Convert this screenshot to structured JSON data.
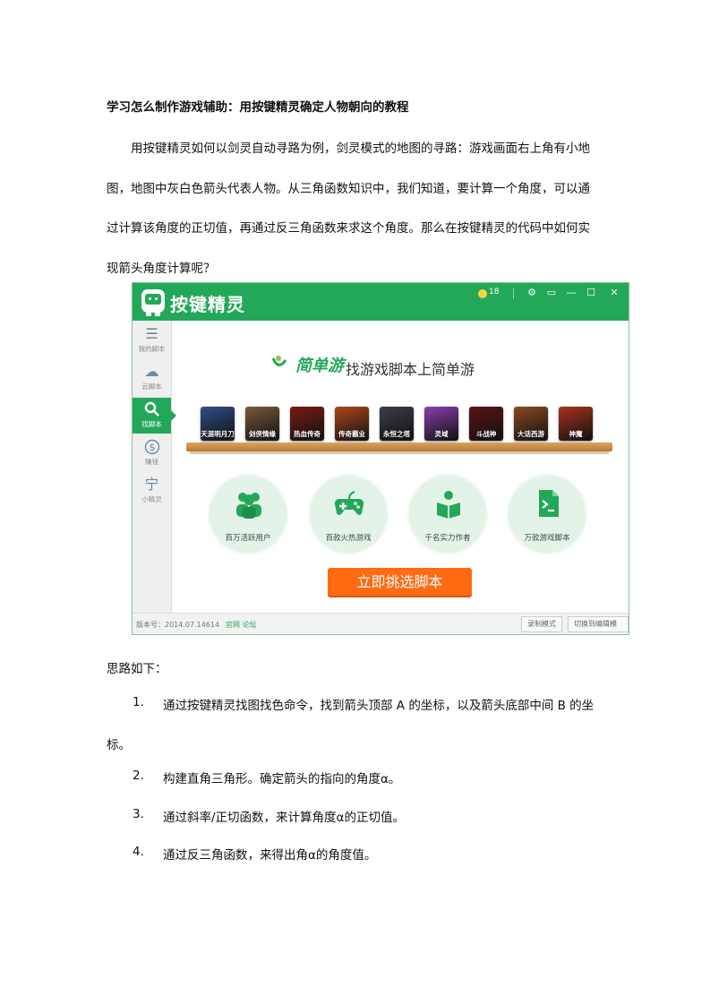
{
  "doc": {
    "title": "学习怎么制作游戏辅助：用按键精灵确定人物朝向的教程",
    "intro_lines": [
      "用按键精灵如何以剑灵自动寻路为例，剑灵模式的地图的寻路：游戏画面右上角有小地",
      "图，地图中灰白色箭头代表人物。从三角函数知识中，我们知道，要计算一个角度，可以通",
      "过计算该角度的正切值，再通过反三角函数来求这个角度。那么在按键精灵的代码中如何实",
      "现箭头角度计算呢？"
    ],
    "steps_heading": "思路如下：",
    "steps": [
      {
        "num": "1.",
        "text": "通过按键精灵找图找色命令，找到箭头顶部 A 的坐标，以及箭头底部中间 B 的坐",
        "cont": "标。"
      },
      {
        "num": "2.",
        "text": "构建直角三角形。确定箭头的指向的角度α。"
      },
      {
        "num": "3.",
        "text": "通过斜率/正切函数，来计算角度α的正切值。"
      },
      {
        "num": "4.",
        "text": "通过反三角函数，来得出角α的角度值。"
      }
    ]
  },
  "app": {
    "title": "按键精灵",
    "coin_value": "18",
    "window_buttons": [
      "⚙",
      "▭",
      "—",
      "☐",
      "✕"
    ],
    "sidebar": [
      {
        "label": "我的脚本",
        "icon": "list-icon"
      },
      {
        "label": "云脚本",
        "icon": "cloud-icon"
      },
      {
        "label": "找脚本",
        "icon": "search-icon"
      },
      {
        "label": "赚钱",
        "icon": "dollar-icon"
      },
      {
        "label": "小精灵",
        "icon": "user-icon"
      }
    ],
    "brand": "简单游",
    "slogan": "找游戏脚本上简单游",
    "games": [
      {
        "label": "天涯明月刀",
        "color": "#2e4f8a"
      },
      {
        "label": "剑侠情缘",
        "color": "#7a5a3a"
      },
      {
        "label": "热血传奇",
        "color": "#7a1a12"
      },
      {
        "label": "传奇霸业",
        "color": "#b0461c"
      },
      {
        "label": "永恒之塔",
        "color": "#3d3d4a"
      },
      {
        "label": "灵域",
        "color": "#8a3fae"
      },
      {
        "label": "斗战神",
        "color": "#5a1414"
      },
      {
        "label": "大话西游",
        "color": "#8a4a22"
      },
      {
        "label": "神魔",
        "color": "#a8321c"
      }
    ],
    "features": [
      {
        "label": "百万活跃用户",
        "icon": "users-icon"
      },
      {
        "label": "百款火热游戏",
        "icon": "gamepad-icon"
      },
      {
        "label": "千名实力作者",
        "icon": "author-icon"
      },
      {
        "label": "万款游戏脚本",
        "icon": "script-icon"
      }
    ],
    "cta": "立即挑选脚本",
    "status": {
      "version": "版本号：2014.07.14614",
      "links": "官网  论坛",
      "btn1": "录制模式",
      "btn2": "切换到编辑模式"
    },
    "accent": "#23a85a",
    "cta_color": "#ff6a12"
  }
}
